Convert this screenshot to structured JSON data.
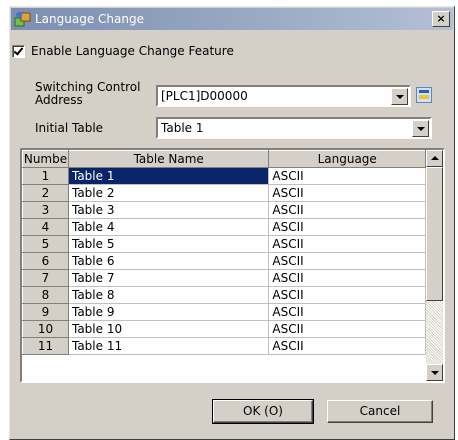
{
  "window": {
    "title": "Language Change",
    "close_label": "×"
  },
  "enable_checkbox": {
    "label": "Enable Language Change Feature",
    "checked": true
  },
  "switching": {
    "label_line1": "Switching Control",
    "label_line2": "Address",
    "value": "[PLC1]D00000"
  },
  "initial_table": {
    "label": "Initial Table",
    "value": "Table 1"
  },
  "grid": {
    "headers": [
      "Numbe",
      "Table Name",
      "Language"
    ],
    "rows": [
      {
        "num": "1",
        "name": "Table 1",
        "lang": "ASCII",
        "selected": true
      },
      {
        "num": "2",
        "name": "Table 2",
        "lang": "ASCII"
      },
      {
        "num": "3",
        "name": "Table 3",
        "lang": "ASCII"
      },
      {
        "num": "4",
        "name": "Table 4",
        "lang": "ASCII"
      },
      {
        "num": "5",
        "name": "Table 5",
        "lang": "ASCII"
      },
      {
        "num": "6",
        "name": "Table 6",
        "lang": "ASCII"
      },
      {
        "num": "7",
        "name": "Table 7",
        "lang": "ASCII"
      },
      {
        "num": "8",
        "name": "Table 8",
        "lang": "ASCII"
      },
      {
        "num": "9",
        "name": "Table 9",
        "lang": "ASCII"
      },
      {
        "num": "10",
        "name": "Table 10",
        "lang": "ASCII"
      },
      {
        "num": "11",
        "name": "Table 11",
        "lang": "ASCII"
      }
    ]
  },
  "buttons": {
    "ok": "OK (O)",
    "cancel": "Cancel"
  },
  "colors": {
    "selection": "#0a246a",
    "face": "#d4d0c8"
  }
}
